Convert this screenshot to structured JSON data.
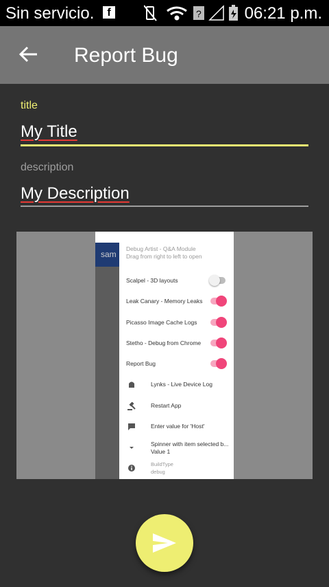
{
  "status": {
    "carrier": "Sin servicio.",
    "time": "06:21 p.m."
  },
  "appbar": {
    "title": "Report Bug"
  },
  "form": {
    "title_label": "title",
    "title_value": "My Title",
    "description_label": "description",
    "description_value": "My Description"
  },
  "screenshot": {
    "side_text": "sam",
    "drawer_header": "Debug Artist - Q&A Module",
    "drawer_subheader": "Drag from right to left to open",
    "items": [
      {
        "label": "Scalpel - 3D layouts",
        "on": false
      },
      {
        "label": "Leak Canary - Memory Leaks",
        "on": true
      },
      {
        "label": "Picasso Image Cache Logs",
        "on": true
      },
      {
        "label": "Stetho - Debug from Chrome",
        "on": true
      },
      {
        "label": "Report Bug",
        "on": true
      }
    ],
    "actions": [
      {
        "label": "Lynks - Live Device Log",
        "icon": "android-icon"
      },
      {
        "label": "Restart App",
        "icon": "gavel-icon"
      },
      {
        "label": "Enter value for 'Host'",
        "icon": "comment-icon"
      },
      {
        "label": "Spinner with item selected b...",
        "sub": "Value 1",
        "icon": "dropdown-icon"
      },
      {
        "label": "BuildType",
        "sub": "debug",
        "icon": "info-icon"
      }
    ]
  },
  "colors": {
    "accent": "#EEEE72",
    "pink": "#F0457A",
    "appbar": "#757575",
    "background": "#303030"
  }
}
